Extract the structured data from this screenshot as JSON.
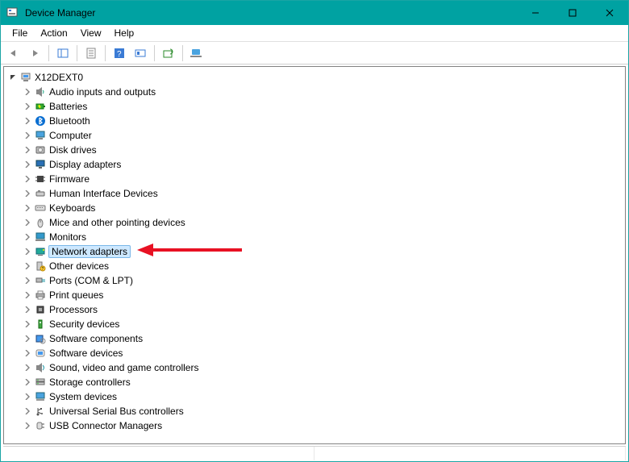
{
  "window": {
    "title": "Device Manager"
  },
  "menus": {
    "file": "File",
    "action": "Action",
    "view": "View",
    "help": "Help"
  },
  "tree": {
    "root": {
      "label": "X12DEXT0",
      "expanded": true
    },
    "categories": [
      {
        "label": "Audio inputs and outputs",
        "icon": "speaker"
      },
      {
        "label": "Batteries",
        "icon": "battery"
      },
      {
        "label": "Bluetooth",
        "icon": "bluetooth"
      },
      {
        "label": "Computer",
        "icon": "computer"
      },
      {
        "label": "Disk drives",
        "icon": "disk"
      },
      {
        "label": "Display adapters",
        "icon": "display"
      },
      {
        "label": "Firmware",
        "icon": "chip"
      },
      {
        "label": "Human Interface Devices",
        "icon": "hid"
      },
      {
        "label": "Keyboards",
        "icon": "keyboard"
      },
      {
        "label": "Mice and other pointing devices",
        "icon": "mouse"
      },
      {
        "label": "Monitors",
        "icon": "monitor"
      },
      {
        "label": "Network adapters",
        "icon": "network",
        "selected": true
      },
      {
        "label": "Other devices",
        "icon": "other"
      },
      {
        "label": "Ports (COM & LPT)",
        "icon": "port"
      },
      {
        "label": "Print queues",
        "icon": "printer"
      },
      {
        "label": "Processors",
        "icon": "cpu"
      },
      {
        "label": "Security devices",
        "icon": "security"
      },
      {
        "label": "Software components",
        "icon": "swc"
      },
      {
        "label": "Software devices",
        "icon": "swd"
      },
      {
        "label": "Sound, video and game controllers",
        "icon": "sound"
      },
      {
        "label": "Storage controllers",
        "icon": "storage"
      },
      {
        "label": "System devices",
        "icon": "system"
      },
      {
        "label": "Universal Serial Bus controllers",
        "icon": "usb"
      },
      {
        "label": "USB Connector Managers",
        "icon": "usbconn"
      }
    ]
  },
  "toolbar_buttons": [
    "back",
    "forward",
    "show-console-tree",
    "properties",
    "help",
    "update-driver",
    "uninstall",
    "scan-hardware",
    "show-hidden"
  ],
  "annotation_arrow_color": "#e81123"
}
